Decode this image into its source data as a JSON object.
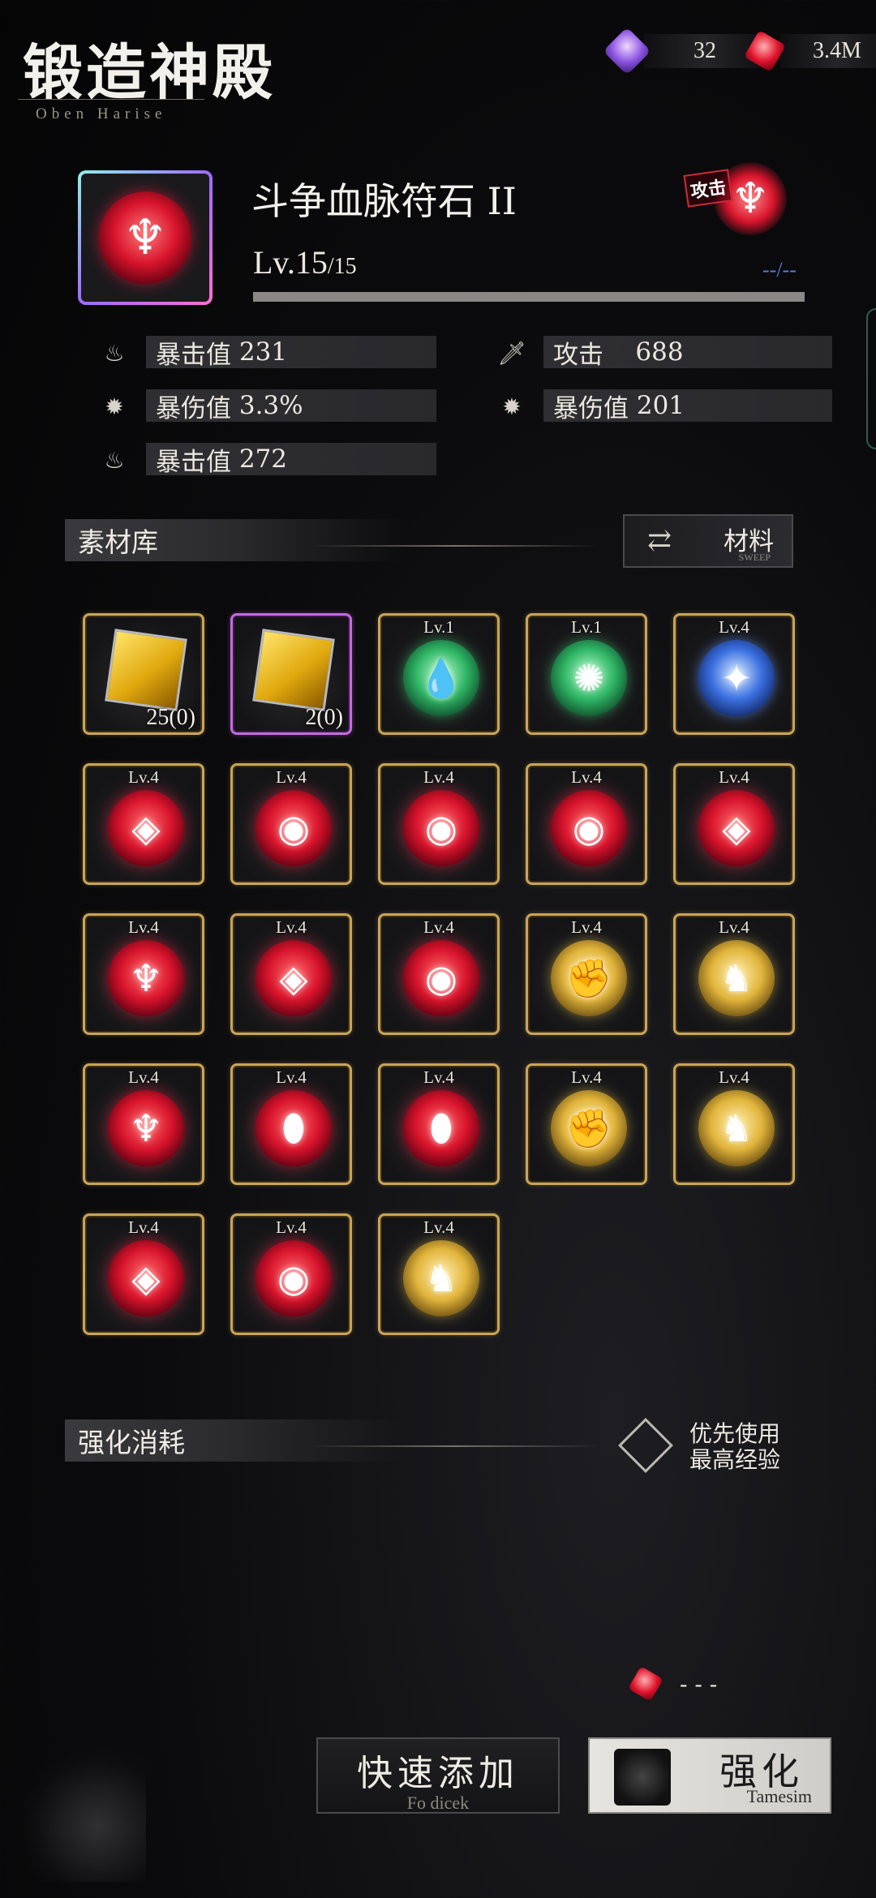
{
  "header": {
    "title_cn": "锻造神殿",
    "title_en": "Oben Harise"
  },
  "currency": [
    {
      "icon": "purple-crystal-plus-icon",
      "value": "32"
    },
    {
      "icon": "red-crystal-icon",
      "value": "3.4M"
    }
  ],
  "item": {
    "name": "斗争血脉符石 II",
    "level": "Lv.15",
    "level_max": "/15",
    "exp_text": "--/--",
    "exp_progress": 1.0,
    "type_tag": "攻击"
  },
  "stats": [
    {
      "icon": "crit-rate-icon",
      "label": "暴击值",
      "value": "231"
    },
    {
      "icon": "sword-icon",
      "label": "攻击",
      "value": "688"
    },
    {
      "icon": "crit-damage-icon",
      "label": "暴伤值",
      "value": "3.3%"
    },
    {
      "icon": "crit-damage-icon",
      "label": "暴伤值",
      "value": "201"
    },
    {
      "icon": "crit-rate-icon",
      "label": "暴击值",
      "value": "272"
    }
  ],
  "materials": {
    "section_title": "素材库",
    "button_label": "材料",
    "button_sub": "SWEEP",
    "items": [
      {
        "kind": "cube",
        "label": "",
        "count": "25(0)",
        "frame": "gold"
      },
      {
        "kind": "cube",
        "label": "",
        "count": "2(0)",
        "frame": "purple"
      },
      {
        "kind": "gem",
        "color": "green",
        "glyph": "💧",
        "label": "Lv.1"
      },
      {
        "kind": "gem",
        "color": "green",
        "glyph": "✺",
        "label": "Lv.1"
      },
      {
        "kind": "gem",
        "color": "blue",
        "glyph": "✦",
        "label": "Lv.4"
      },
      {
        "kind": "gem",
        "color": "red",
        "glyph": "◈",
        "label": "Lv.4"
      },
      {
        "kind": "gem",
        "color": "red",
        "glyph": "◉",
        "label": "Lv.4"
      },
      {
        "kind": "gem",
        "color": "red",
        "glyph": "◉",
        "label": "Lv.4"
      },
      {
        "kind": "gem",
        "color": "red",
        "glyph": "◉",
        "label": "Lv.4"
      },
      {
        "kind": "gem",
        "color": "red",
        "glyph": "◈",
        "label": "Lv.4"
      },
      {
        "kind": "gem",
        "color": "red",
        "glyph": "♆",
        "label": "Lv.4"
      },
      {
        "kind": "gem",
        "color": "red",
        "glyph": "◈",
        "label": "Lv.4"
      },
      {
        "kind": "gem",
        "color": "red",
        "glyph": "◉",
        "label": "Lv.4"
      },
      {
        "kind": "gem",
        "color": "gold",
        "glyph": "✊",
        "label": "Lv.4"
      },
      {
        "kind": "gem",
        "color": "gold",
        "glyph": "♞",
        "label": "Lv.4"
      },
      {
        "kind": "gem",
        "color": "red",
        "glyph": "♆",
        "label": "Lv.4"
      },
      {
        "kind": "gem",
        "color": "red",
        "glyph": "⬮",
        "label": "Lv.4"
      },
      {
        "kind": "gem",
        "color": "red",
        "glyph": "⬮",
        "label": "Lv.4"
      },
      {
        "kind": "gem",
        "color": "gold",
        "glyph": "✊",
        "label": "Lv.4"
      },
      {
        "kind": "gem",
        "color": "gold",
        "glyph": "♞",
        "label": "Lv.4"
      },
      {
        "kind": "gem",
        "color": "red",
        "glyph": "◈",
        "label": "Lv.4"
      },
      {
        "kind": "gem",
        "color": "red",
        "glyph": "◉",
        "label": "Lv.4"
      },
      {
        "kind": "gem",
        "color": "gold",
        "glyph": "♞",
        "label": "Lv.4"
      }
    ]
  },
  "cost": {
    "section_title": "强化消耗",
    "option_label_1": "优先使用",
    "option_label_2": "最高经验",
    "cost_value": "- - -"
  },
  "buttons": {
    "quick_add": "快速添加",
    "quick_add_sub": "Fo dicek",
    "enhance": "强化",
    "enhance_sub": "Tamesim"
  },
  "colors": {
    "gold_frame": "#c9a55a",
    "purple_frame": "#c56be0",
    "exp_text": "#5d7bd6"
  }
}
